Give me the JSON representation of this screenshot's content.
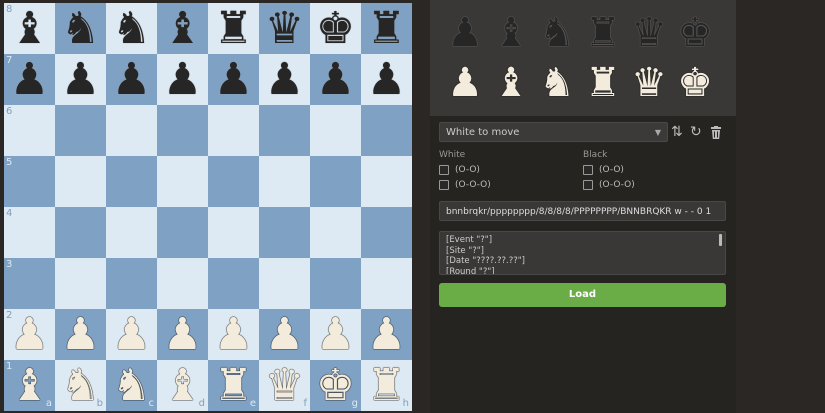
{
  "board": {
    "rank_labels": [
      "8",
      "7",
      "6",
      "5",
      "4",
      "3",
      "2",
      "1"
    ],
    "file_labels": [
      "a",
      "b",
      "c",
      "d",
      "e",
      "f",
      "g",
      "h"
    ],
    "ranks": [
      [
        "bB",
        "bN",
        "bN",
        "bB",
        "bR",
        "bQ",
        "bK",
        "bR"
      ],
      [
        "bP",
        "bP",
        "bP",
        "bP",
        "bP",
        "bP",
        "bP",
        "bP"
      ],
      [
        "",
        "",
        "",
        "",
        "",
        "",
        "",
        ""
      ],
      [
        "",
        "",
        "",
        "",
        "",
        "",
        "",
        ""
      ],
      [
        "",
        "",
        "",
        "",
        "",
        "",
        "",
        ""
      ],
      [
        "",
        "",
        "",
        "",
        "",
        "",
        "",
        ""
      ],
      [
        "wP",
        "wP",
        "wP",
        "wP",
        "wP",
        "wP",
        "wP",
        "wP"
      ],
      [
        "wB",
        "wN",
        "wN",
        "wB",
        "wR",
        "wQ",
        "wK",
        "wR"
      ]
    ]
  },
  "spare_pieces": {
    "black": [
      "bP",
      "bB",
      "bN",
      "bR",
      "bQ",
      "bK"
    ],
    "white": [
      "wP",
      "wB",
      "wN",
      "wR",
      "wQ",
      "wK"
    ]
  },
  "glyphs": {
    "K": "♚",
    "Q": "♛",
    "R": "♜",
    "B": "♝",
    "N": "♞",
    "P": "♟"
  },
  "turn_select": {
    "value": "White to move"
  },
  "castling": {
    "white_header": "White",
    "black_header": "Black",
    "white_kingside": "(O-O)",
    "white_queenside": "(O-O-O)",
    "black_kingside": "(O-O)",
    "black_queenside": "(O-O-O)"
  },
  "fen": "bnnbrqkr/pppppppp/8/8/8/8/PPPPPPPP/BNNBRQKR w - - 0 1",
  "pgn_lines": [
    "[Event \"?\"]",
    "[Site \"?\"]",
    "[Date \"????.??.??\"]",
    "[Round \"?\"]"
  ],
  "load_button": "Load",
  "colors": {
    "light_square": "#dde9f3",
    "dark_square": "#7fa1c3",
    "load_button": "#6aad47",
    "panel_bg": "#262421"
  },
  "icons": [
    "flip-board-icon",
    "reset-icon",
    "trash-icon",
    "chevron-down-icon"
  ]
}
